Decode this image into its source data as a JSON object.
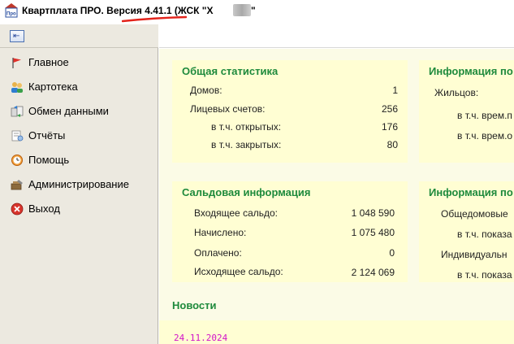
{
  "window": {
    "title": "Квартплата ПРО.  Версия 4.41.1 (ЖСК \"Х",
    "title_tail": "\"",
    "app_icon": "pro-logo-icon"
  },
  "sidebar": {
    "collapse_icon": "collapse-panel-icon",
    "items": [
      {
        "label": "Главное",
        "icon": "flag-icon"
      },
      {
        "label": "Картотека",
        "icon": "people-icon"
      },
      {
        "label": "Обмен данными",
        "icon": "exchange-icon"
      },
      {
        "label": "Отчёты",
        "icon": "reports-icon"
      },
      {
        "label": "Помощь",
        "icon": "help-clock-icon"
      },
      {
        "label": "Администрирование",
        "icon": "admin-tools-icon"
      },
      {
        "label": "Выход",
        "icon": "exit-icon"
      }
    ]
  },
  "stats": {
    "title": "Общая статистика",
    "rows": [
      {
        "label": "Домов:",
        "value": "1"
      },
      {
        "label": "Лицевых счетов:",
        "value": "256"
      },
      {
        "label": "в т.ч. открытых:",
        "value": "176"
      },
      {
        "label": "в т.ч. закрытых:",
        "value": "80"
      }
    ]
  },
  "info1": {
    "title": "Информация по",
    "rows": [
      {
        "label": "Жильцов:"
      },
      {
        "label": "в т.ч. врем.п"
      },
      {
        "label": "в т.ч. врем.о"
      }
    ]
  },
  "saldo": {
    "title": "Сальдовая информация",
    "rows": [
      {
        "label": "Входящее сальдо:",
        "value": "1 048 590"
      },
      {
        "label": "Начислено:",
        "value": "1 075 480"
      },
      {
        "label": "Оплачено:",
        "value": "0"
      },
      {
        "label": "Исходящее сальдо:",
        "value": "2 124 069"
      }
    ]
  },
  "info2": {
    "title": "Информация по",
    "rows": [
      {
        "label": "Общедомовые"
      },
      {
        "label": "в т.ч. показа"
      },
      {
        "label": "Индивидуальн"
      },
      {
        "label": "в т.ч. показа"
      }
    ]
  },
  "news": {
    "title": "Новости",
    "date": "24.11.2024"
  },
  "colors": {
    "accent_green": "#1e8a3c",
    "panel_bg": "#fffed3",
    "news_date": "#d214c8",
    "sidebar_bg": "#ece9e0"
  }
}
